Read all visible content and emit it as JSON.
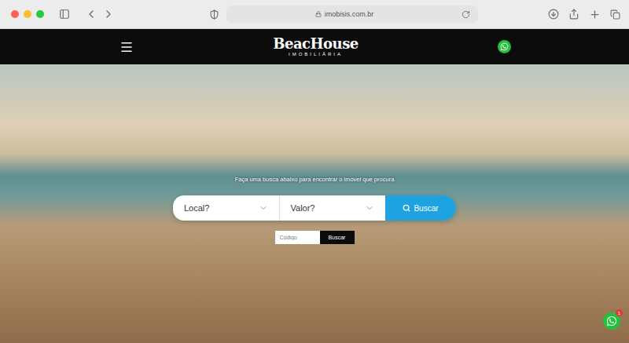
{
  "browser": {
    "address": "imobisis.com.br"
  },
  "header": {
    "logo": {
      "name": "BeacHouse",
      "subtitle": "IMOBILIÁRIA"
    }
  },
  "hero": {
    "prompt": "Faça uma busca abaixo para encontrar o imóvel que procura",
    "search": {
      "fields": [
        {
          "placeholder": "Local?"
        },
        {
          "placeholder": "Valor?"
        }
      ],
      "button": "Buscar"
    },
    "code_search": {
      "placeholder": "Código",
      "button": "Buscar"
    }
  },
  "chat": {
    "badge": "1"
  }
}
